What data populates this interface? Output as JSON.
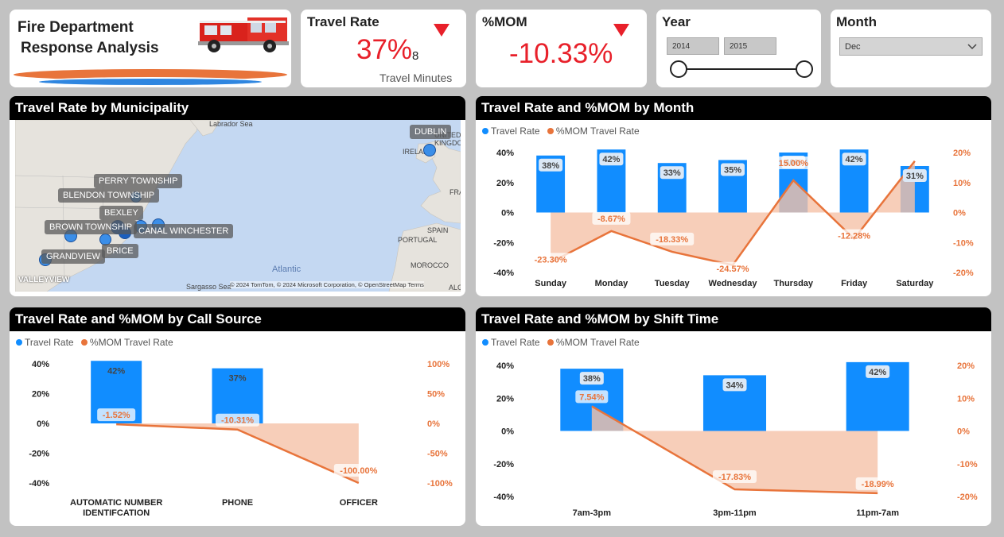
{
  "title": {
    "line1": "Fire Department",
    "line2": "Response Analysis"
  },
  "kpi_travel": {
    "title": "Travel Rate",
    "value": "37%",
    "sub": "8",
    "caption": "Travel Minutes"
  },
  "kpi_mom": {
    "title": "%MOM",
    "value": "-10.33%"
  },
  "year": {
    "title": "Year",
    "from": "2014",
    "to": "2015"
  },
  "month": {
    "title": "Month",
    "selected": "Dec"
  },
  "colors": {
    "blue": "#118dff",
    "orange": "#e8743b",
    "orange_fill": "#f5c2a8",
    "red": "#e8202a"
  },
  "map_panel": {
    "title": "Travel Rate by Municipality",
    "labels": [
      "DUBLIN",
      "PERRY TOWNSHIP",
      "BLENDON TOWNSHIP",
      "BEXLEY",
      "BROWN TOWNSHIP",
      "CANAL WINCHESTER",
      "BRICE",
      "GRANDVIEW"
    ],
    "geo": [
      "Labrador Sea",
      "UNITED KINGDOM",
      "IRELAND",
      "FRA",
      "SPAIN",
      "PORTUGAL",
      "MOROCCO",
      "ALG",
      "Atlantic",
      "Sargasso Sea"
    ],
    "brand": "VALLEYVIEW",
    "copyright": "© 2024 TomTom, © 2024 Microsoft Corporation, © OpenStreetMap  Terms"
  },
  "legend": {
    "travel": "Travel Rate",
    "mom": "%MOM Travel Rate"
  },
  "chart_data": [
    {
      "type": "bar",
      "title": "Travel Rate and %MOM by Month",
      "categories": [
        "Sunday",
        "Monday",
        "Tuesday",
        "Wednesday",
        "Thursday",
        "Friday",
        "Saturday"
      ],
      "series": [
        {
          "name": "Travel Rate",
          "values": [
            38,
            42,
            33,
            35,
            40,
            42,
            31
          ],
          "labels": [
            "38%",
            "42%",
            "33%",
            "35%",
            "40%",
            "42%",
            "31%"
          ]
        },
        {
          "name": "%MOM Travel Rate",
          "values": [
            -23.3,
            -8.67,
            -18.33,
            -24.57,
            15.0,
            -12.28,
            24
          ],
          "labels": [
            "-23.30%",
            "-8.67%",
            "-18.33%",
            "-24.57%",
            "15.00%",
            "-12.28%",
            ""
          ]
        }
      ],
      "y_ticks": [
        "40%",
        "20%",
        "0%",
        "-20%",
        "-40%"
      ],
      "y2_ticks": [
        "20%",
        "10%",
        "0%",
        "-10%",
        "-20%"
      ],
      "ylim": [
        -40,
        40
      ],
      "y2lim": [
        -28,
        28
      ]
    },
    {
      "type": "bar",
      "title": "Travel Rate and %MOM by Call Source",
      "categories": [
        "AUTOMATIC NUMBER IDENTIFCATION",
        "PHONE",
        "OFFICER"
      ],
      "series": [
        {
          "name": "Travel Rate",
          "values": [
            42,
            37,
            0
          ],
          "labels": [
            "42%",
            "37%",
            ""
          ]
        },
        {
          "name": "%MOM Travel Rate",
          "values": [
            -1.52,
            -10.31,
            -100
          ],
          "labels": [
            "-1.52%",
            "-10.31%",
            "-100.00%"
          ]
        }
      ],
      "y_ticks": [
        "40%",
        "20%",
        "0%",
        "-20%",
        "-40%"
      ],
      "y2_ticks": [
        "100%",
        "50%",
        "0%",
        "-50%",
        "-100%"
      ],
      "ylim": [
        -40,
        40
      ],
      "y2lim": [
        -100,
        100
      ]
    },
    {
      "type": "bar",
      "title": "Travel Rate and %MOM by Shift Time",
      "categories": [
        "7am-3pm",
        "3pm-11pm",
        "11pm-7am"
      ],
      "series": [
        {
          "name": "Travel Rate",
          "values": [
            38,
            34,
            42
          ],
          "labels": [
            "38%",
            "34%",
            "42%"
          ]
        },
        {
          "name": "%MOM Travel Rate",
          "values": [
            7.54,
            -17.83,
            -18.99
          ],
          "labels": [
            "7.54%",
            "-17.83%",
            "-18.99%"
          ]
        }
      ],
      "y_ticks": [
        "40%",
        "20%",
        "0%",
        "-20%",
        "-40%"
      ],
      "y2_ticks": [
        "20%",
        "10%",
        "0%",
        "-10%",
        "-20%"
      ],
      "ylim": [
        -40,
        40
      ],
      "y2lim": [
        -20,
        20
      ]
    }
  ]
}
